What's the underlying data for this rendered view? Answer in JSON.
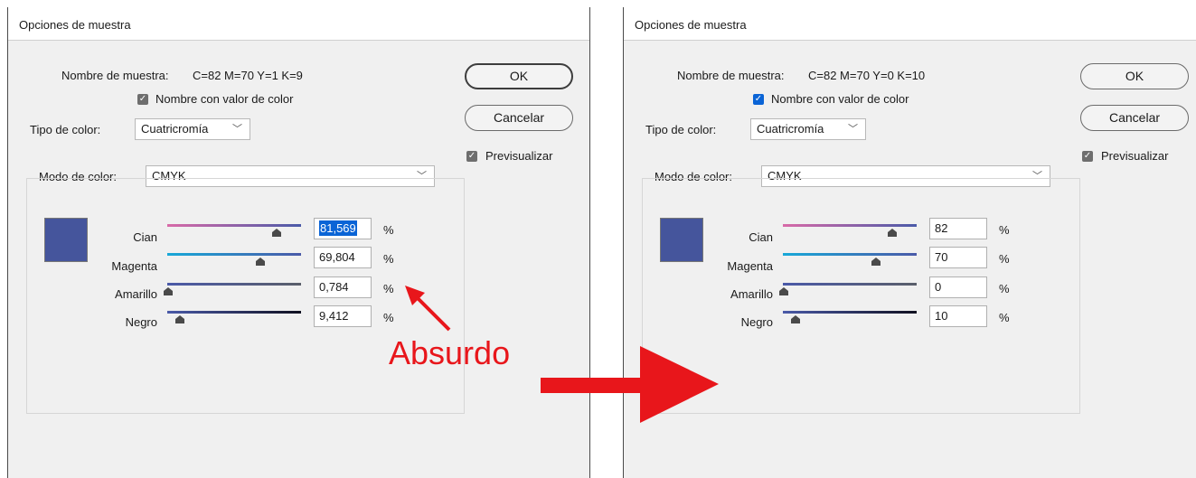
{
  "left": {
    "title": "Opciones de muestra",
    "swatch_name_label": "Nombre de muestra:",
    "swatch_name_value": "C=82 M=70 Y=1 K=9",
    "name_with_color_value": "Nombre con valor de color",
    "color_type_label": "Tipo de color:",
    "color_type_value": "Cuatricromía",
    "color_mode_label": "Modo de color:",
    "color_mode_value": "CMYK",
    "ok_label": "OK",
    "cancel_label": "Cancelar",
    "preview_label": "Previsualizar",
    "channels": [
      {
        "label": "Cian",
        "value": "81,569",
        "percent": "%"
      },
      {
        "label": "Magenta",
        "value": "69,804",
        "percent": "%"
      },
      {
        "label": "Amarillo",
        "value": "0,784",
        "percent": "%"
      },
      {
        "label": "Negro",
        "value": "9,412",
        "percent": "%"
      }
    ]
  },
  "right": {
    "title": "Opciones de muestra",
    "swatch_name_label": "Nombre de muestra:",
    "swatch_name_value": "C=82 M=70 Y=0 K=10",
    "name_with_color_value": "Nombre con valor de color",
    "color_type_label": "Tipo de color:",
    "color_type_value": "Cuatricromía",
    "color_mode_label": "Modo de color:",
    "color_mode_value": "CMYK",
    "ok_label": "OK",
    "cancel_label": "Cancelar",
    "preview_label": "Previsualizar",
    "channels": [
      {
        "label": "Cian",
        "value": "82",
        "percent": "%"
      },
      {
        "label": "Magenta",
        "value": "70",
        "percent": "%"
      },
      {
        "label": "Amarillo",
        "value": "0",
        "percent": "%"
      },
      {
        "label": "Negro",
        "value": "10",
        "percent": "%"
      }
    ]
  },
  "annotation": {
    "text": "Absurdo",
    "color": "#e8161b"
  },
  "colors": {
    "swatch": "#45559c",
    "accent": "#0a64d6"
  }
}
